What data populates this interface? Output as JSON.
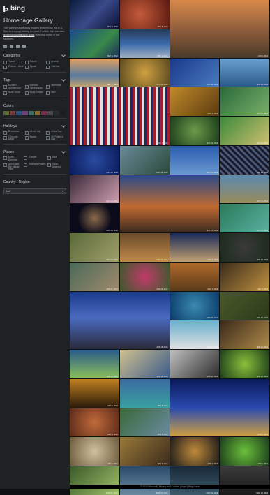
{
  "brand": {
    "name": "bing"
  },
  "page": {
    "title": "Homepage Gallery",
    "description_pre": "This gallery showcases images featured on the U.S. Bing homepage during the past 3 years. You can also ",
    "description_link": "download a wallpaper pack",
    "description_post": " featuring some of our favorites."
  },
  "social": [
    "facebook-icon",
    "twitter-icon",
    "email-icon",
    "rss-icon"
  ],
  "filters": {
    "categories": {
      "label": "Categories",
      "options": [
        "Travel",
        "Nature",
        "Animal",
        "Culture / Work",
        "Space",
        "Science"
      ]
    },
    "tags": {
      "label": "Tags",
      "options": [
        "Modern Architecture",
        "Ultimate Landscapes",
        "Mammals",
        "Rock Lines",
        "Body Details",
        "Bird"
      ]
    },
    "colors": {
      "label": "Colors",
      "swatches": [
        "#5b6b35",
        "#7a3a3a",
        "#2f4e7a",
        "#6a3f7a",
        "#3f6a6a",
        "#8a6a2a",
        "#7a2a4a",
        "#4a4a4a",
        "#2a2a2a",
        "#1c1c1c"
      ]
    },
    "holidays": {
      "label": "Holidays",
      "options": [
        "Christmas",
        "4th of July",
        "Arbor Day",
        "Cinqo de Mayo",
        "Easter",
        "St. Patrick's Day"
      ]
    },
    "places": {
      "label": "Places",
      "options": [
        "North America",
        "Europe",
        "Asia",
        "Africa and the Middle East",
        "Australia/Pacific",
        "South America"
      ]
    },
    "country": {
      "label": "Country / Region",
      "value": "Ind"
    }
  },
  "gallery": {
    "captions": [
      "MAY 8, 2014",
      "MAY 8, 2014",
      "JUN 6, 2014",
      "MAY 5, 2014",
      "MAY 2, 2014",
      "MAY 1, 2014",
      "MAY 26, 2014",
      "MAY 25, 2014",
      "MAY 19, 2014",
      "MAY 7, 2014",
      "MAY 2, 2014",
      "MAY 27, 2014",
      "MAY 23, 2014",
      "MAY 26, 2014",
      "MAY 22, 2014",
      "MAY 20, 2014",
      "MAY 21, 2014",
      "APR 26, 2014",
      "MAY 18, 2014",
      "MAY 15, 2014",
      "MAY 14, 2014",
      "MAY 13, 2014",
      "MAY 12, 2014",
      "MAY 10, 2014",
      "MAY 11, 2014",
      "MAY 9, 2014",
      "APR 28, 2014",
      "APR 27, 2014",
      "APR 24, 2014",
      "MAY 4, 2014",
      "MAY 3, 2014",
      "APR 19, 2014",
      "APR 23, 2014",
      "APR 17, 2014",
      "APR 15, 2014",
      "APR 14, 2014",
      "APR 13, 2014",
      "APR 12, 2014",
      "APR 11, 2014",
      "APR 10, 2014",
      "APR 9, 2014",
      "APR 8, 2014",
      "APR 7, 2014",
      "APR 6, 2014",
      "APR 5, 2014",
      "APR 4, 2014",
      "APR 3, 2014",
      "APR 2, 2014",
      "APR 1, 2014",
      "MAR 31, 2014",
      "MAR 30, 2014",
      "MAR 29, 2014",
      "MAR 28, 2014",
      "MAR 27, 2014",
      "MAR 26, 2014",
      "MAR 25, 2014",
      "MAR 24, 2014",
      "MAR 23, 2014"
    ]
  },
  "footer": {
    "text": "© 2014 Microsoft  |  Privacy and Cookies  |  Legal  |  Bing Home"
  }
}
